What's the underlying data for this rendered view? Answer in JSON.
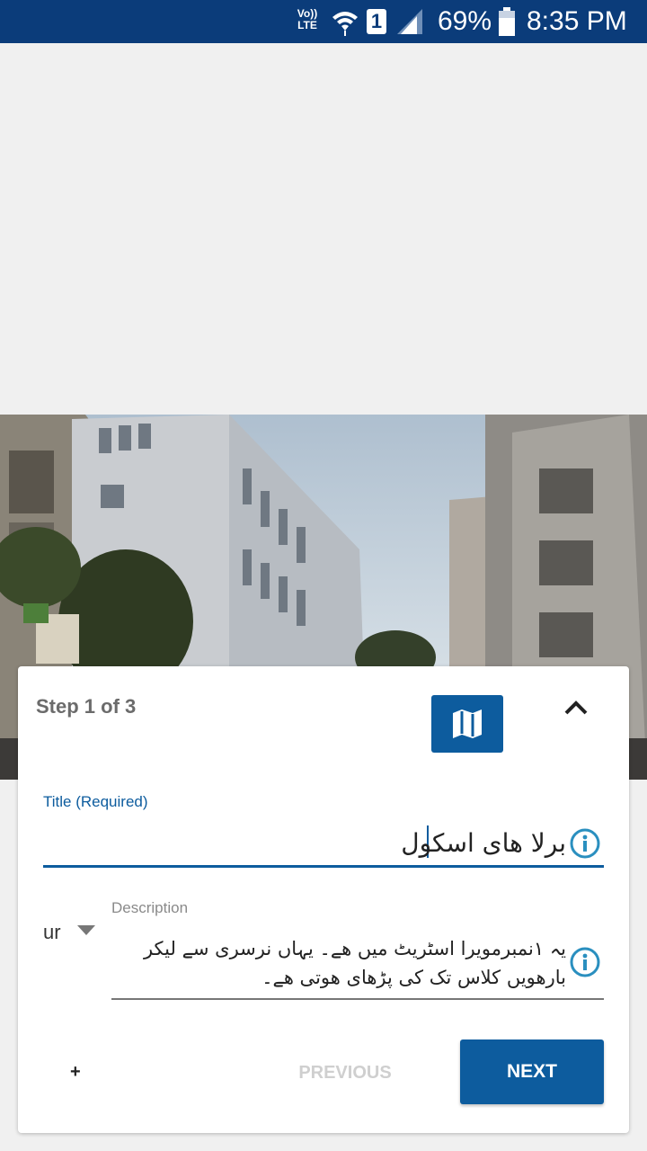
{
  "status_bar": {
    "network": "Vo)) LTE",
    "sim_slot": "1",
    "battery_percent": "69%",
    "time": "8:35 PM"
  },
  "photo": {
    "subject": "street with buildings"
  },
  "card": {
    "step_text": "Step 1 of 3",
    "map_icon": "map-icon",
    "collapse_icon": "chevron-up-icon",
    "title_label": "Title (Required)",
    "title_value": "برلا ھای اسکول",
    "language": "ur",
    "description_label": "Description",
    "description_value": "یہ ۱نمبرمویرا اسٹریٹ میں ھے۔ یہاں نرسری سے لیکر بارھویں کلاس تک کی پڑھای ھوتی ھے۔",
    "add_label": "+",
    "previous_label": "PREVIOUS",
    "next_label": "NEXT"
  },
  "colors": {
    "status_bar": "#0b3c7a",
    "accent": "#0d5c9e",
    "info_icon": "#2a8fbf"
  }
}
